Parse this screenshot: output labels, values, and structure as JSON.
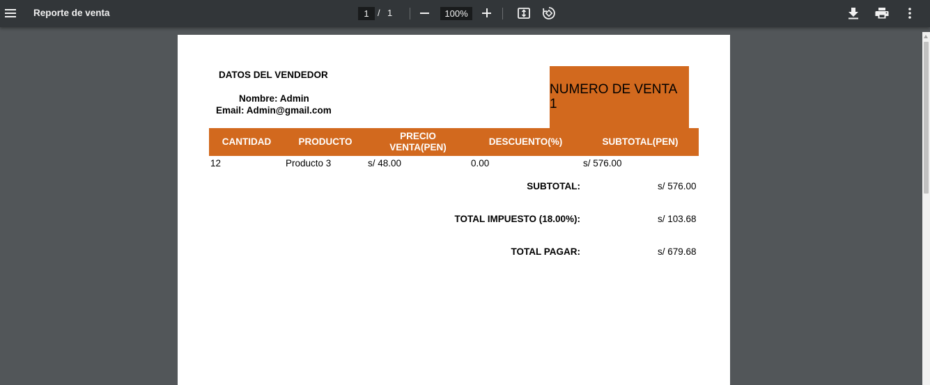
{
  "viewer": {
    "title": "Reporte de venta",
    "current_page": "1",
    "page_separator": "/",
    "total_pages": "1",
    "zoom": "100%"
  },
  "document": {
    "seller": {
      "heading": "DATOS DEL VENDEDOR",
      "name_line": "Nombre: Admin",
      "email_line": "Email: Admin@gmail.com"
    },
    "sale": {
      "label": "NUMERO DE VENTA",
      "number": "1"
    },
    "table": {
      "headers": [
        "CANTIDAD",
        "PRODUCTO",
        "PRECIO\nVENTA(PEN)",
        "DESCUENTO(%)",
        "SUBTOTAL(PEN)"
      ],
      "rows": [
        [
          "12",
          "Producto 3",
          "s/ 48.00",
          "0.00",
          "s/ 576.00"
        ]
      ]
    },
    "totals": {
      "subtotal_label": "SUBTOTAL:",
      "subtotal_value": "s/ 576.00",
      "tax_label": "TOTAL IMPUESTO (18.00%):",
      "tax_value": "s/ 103.68",
      "total_label": "TOTAL PAGAR:",
      "total_value": "s/ 679.68"
    }
  },
  "colors": {
    "accent": "#d2691e",
    "toolbar": "#323639",
    "background": "#525659"
  },
  "icons": [
    "menu-icon",
    "minus-icon",
    "plus-icon",
    "fit-to-page-icon",
    "rotate-icon",
    "download-icon",
    "print-icon",
    "more-vert-icon"
  ]
}
